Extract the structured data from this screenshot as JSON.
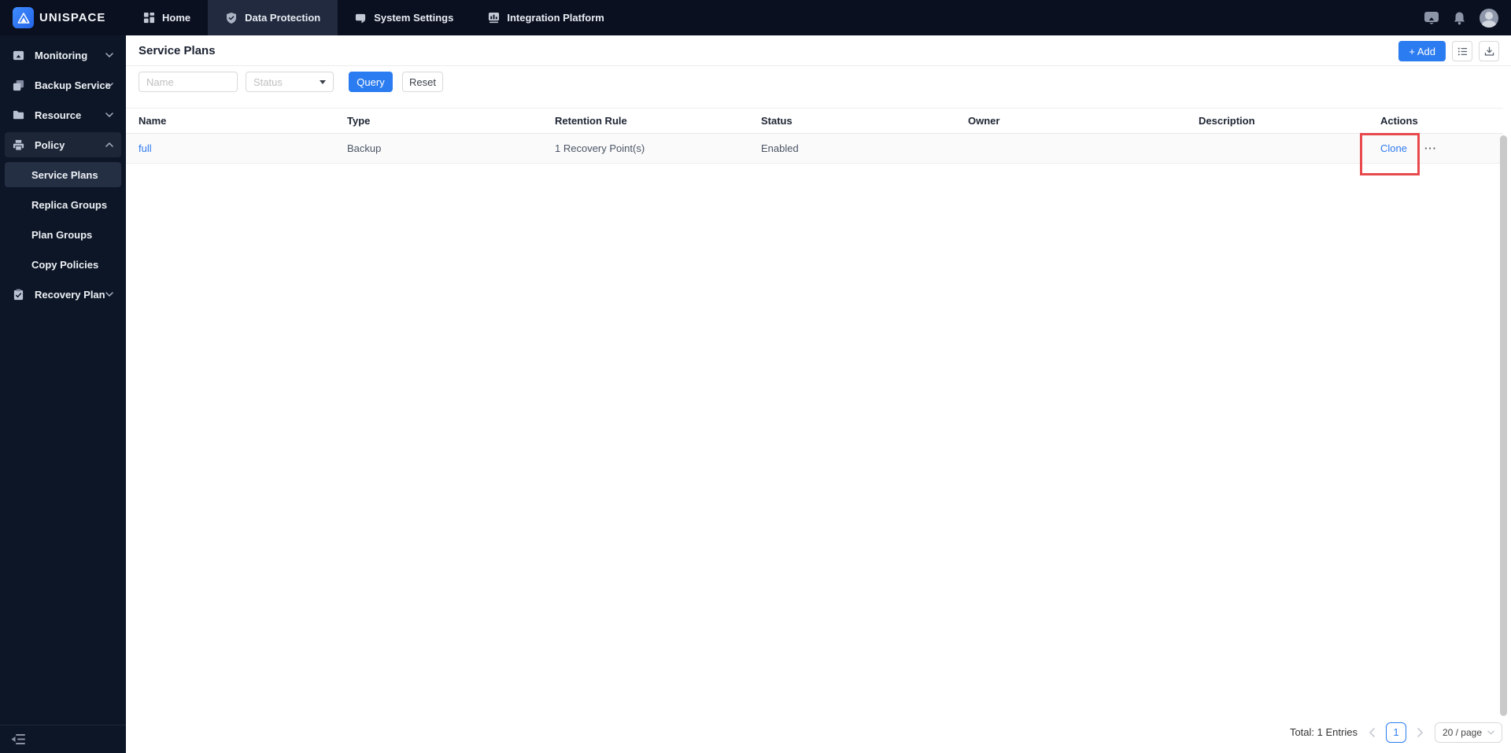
{
  "app": {
    "name": "UNISPACE"
  },
  "topbar": {
    "tabs": [
      {
        "label": "Home"
      },
      {
        "label": "Data Protection"
      },
      {
        "label": "System Settings"
      },
      {
        "label": "Integration Platform"
      }
    ]
  },
  "sidebar": {
    "items": [
      {
        "label": "Monitoring"
      },
      {
        "label": "Backup Service"
      },
      {
        "label": "Resource"
      },
      {
        "label": "Policy"
      },
      {
        "label": "Recovery Plan"
      }
    ],
    "policy_children": [
      {
        "label": "Service Plans"
      },
      {
        "label": "Replica Groups"
      },
      {
        "label": "Plan Groups"
      },
      {
        "label": "Copy Policies"
      }
    ]
  },
  "page": {
    "title": "Service Plans",
    "add_button": "+ Add",
    "filters": {
      "name_placeholder": "Name",
      "status_placeholder": "Status",
      "query_button": "Query",
      "reset_button": "Reset"
    }
  },
  "table": {
    "columns": [
      "Name",
      "Type",
      "Retention Rule",
      "Status",
      "Owner",
      "Description",
      "Actions"
    ],
    "rows": [
      {
        "name": "full",
        "type": "Backup",
        "retention_rule": "1 Recovery Point(s)",
        "status": "Enabled",
        "owner": "",
        "description": "",
        "action": "Clone",
        "more": "···"
      }
    ]
  },
  "pagination": {
    "total": "Total: 1 Entries",
    "current_page": "1",
    "page_size": "20 / page"
  },
  "colors": {
    "accent_blue": "#2b7cf0",
    "annotation_red": "#e8494d",
    "topbar_bg": "#0a101f",
    "sidebar_bg": "#0d1626"
  }
}
